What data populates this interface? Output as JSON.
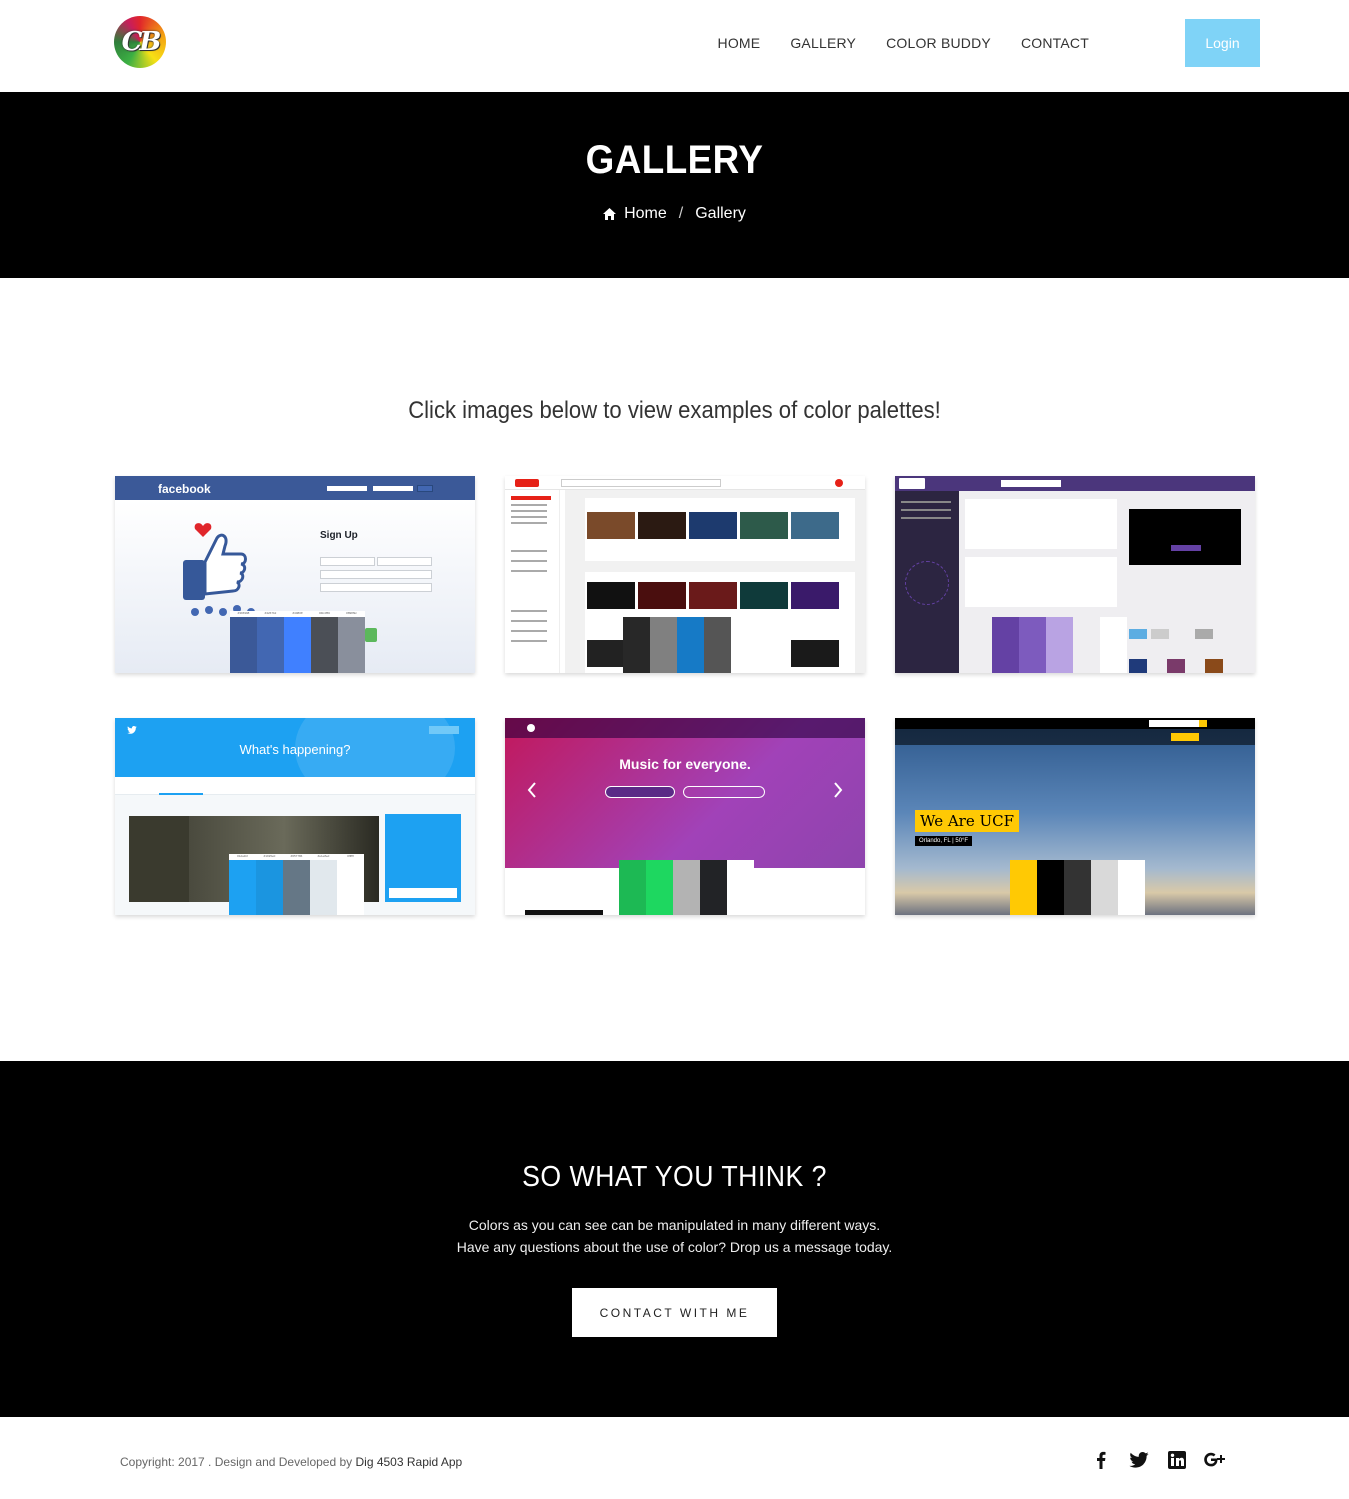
{
  "nav": {
    "logo_text": "CB",
    "items": [
      {
        "label": "HOME"
      },
      {
        "label": "GALLERY"
      },
      {
        "label": "COLOR BUDDY"
      },
      {
        "label": "CONTACT"
      }
    ],
    "login_label": "Login",
    "login_color": "#7fd3f7"
  },
  "banner": {
    "title": "GALLERY",
    "breadcrumb_home": "Home",
    "breadcrumb_sep": "/",
    "breadcrumb_current": "Gallery"
  },
  "gallery": {
    "intro": "Click images below to view examples of color palettes!",
    "items": [
      {
        "name": "facebook",
        "header_text": "facebook",
        "body_text": "Sign Up",
        "palette_labels": [
          "#3b5998",
          "#4267b2",
          "#4080ff",
          "#4b4f56",
          "#898f9c"
        ],
        "palette": [
          "#3b5998",
          "#4267b2",
          "#4080ff",
          "#4b4f56",
          "#898f9c"
        ]
      },
      {
        "name": "youtube",
        "palette": [
          "#282828",
          "#808080",
          "#167ac6",
          "#555555"
        ]
      },
      {
        "name": "twitch",
        "palette": [
          "#6441a4",
          "#7d5bbe",
          "#b9a3e3",
          "#efeef1",
          "#ffffff"
        ]
      },
      {
        "name": "twitter",
        "header_text": "What's happening?",
        "palette_labels": [
          "#1da1f2",
          "#1b95e0",
          "#657786",
          "#e1e8ed",
          "#ffffff"
        ],
        "palette": [
          "#1da1f2",
          "#1b95e0",
          "#657786",
          "#e1e8ed",
          "#ffffff"
        ]
      },
      {
        "name": "spotify",
        "header_text": "Music for everyone.",
        "palette": [
          "#1db954",
          "#1ed760",
          "#b3b3b3",
          "#222326",
          "#ffffff"
        ]
      },
      {
        "name": "ucf",
        "header_text": "We Are UCF",
        "sub_text": "Orlando, FL | 50°F",
        "palette": [
          "#ffc904",
          "#000000",
          "#333333",
          "#d9d9d9",
          "#ffffff"
        ]
      }
    ]
  },
  "cta": {
    "title": "SO WHAT YOU THINK ?",
    "line1": "Colors as you can see can be manipulated in many different ways.",
    "line2": "Have any questions about the use of color? Drop us a message today.",
    "button_label": "CONTACT WITH ME"
  },
  "footer": {
    "copyright": "Copyright: 2017 . Design and Developed by ",
    "developer": "Dig 4503 Rapid App",
    "socials": [
      "facebook-icon",
      "twitter-icon",
      "linkedin-icon",
      "google-plus-icon"
    ]
  }
}
